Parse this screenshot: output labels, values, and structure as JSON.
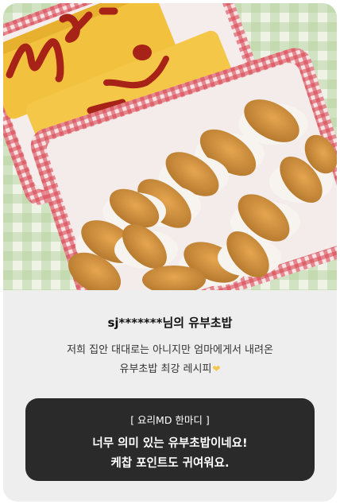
{
  "review": {
    "title": "sj*******님의 유부초밥",
    "description_line1": "저희 집안 대대로는 아니지만 엄마에게서 내려온",
    "description_line2": "유부초밥 최강 레시피",
    "heart_icon": "yellow-heart-emoji"
  },
  "md_comment": {
    "label": "[ 요리MD 한마디 ]",
    "line1": "너무 의미 있는 유부초밥이네요!",
    "line2": "케찹 포인트도 귀여워요."
  },
  "colors": {
    "card_background": "#eeeeee",
    "comment_box": "#2a2a2a",
    "comment_text": "#ffffff",
    "heart": "#f5c84c"
  }
}
